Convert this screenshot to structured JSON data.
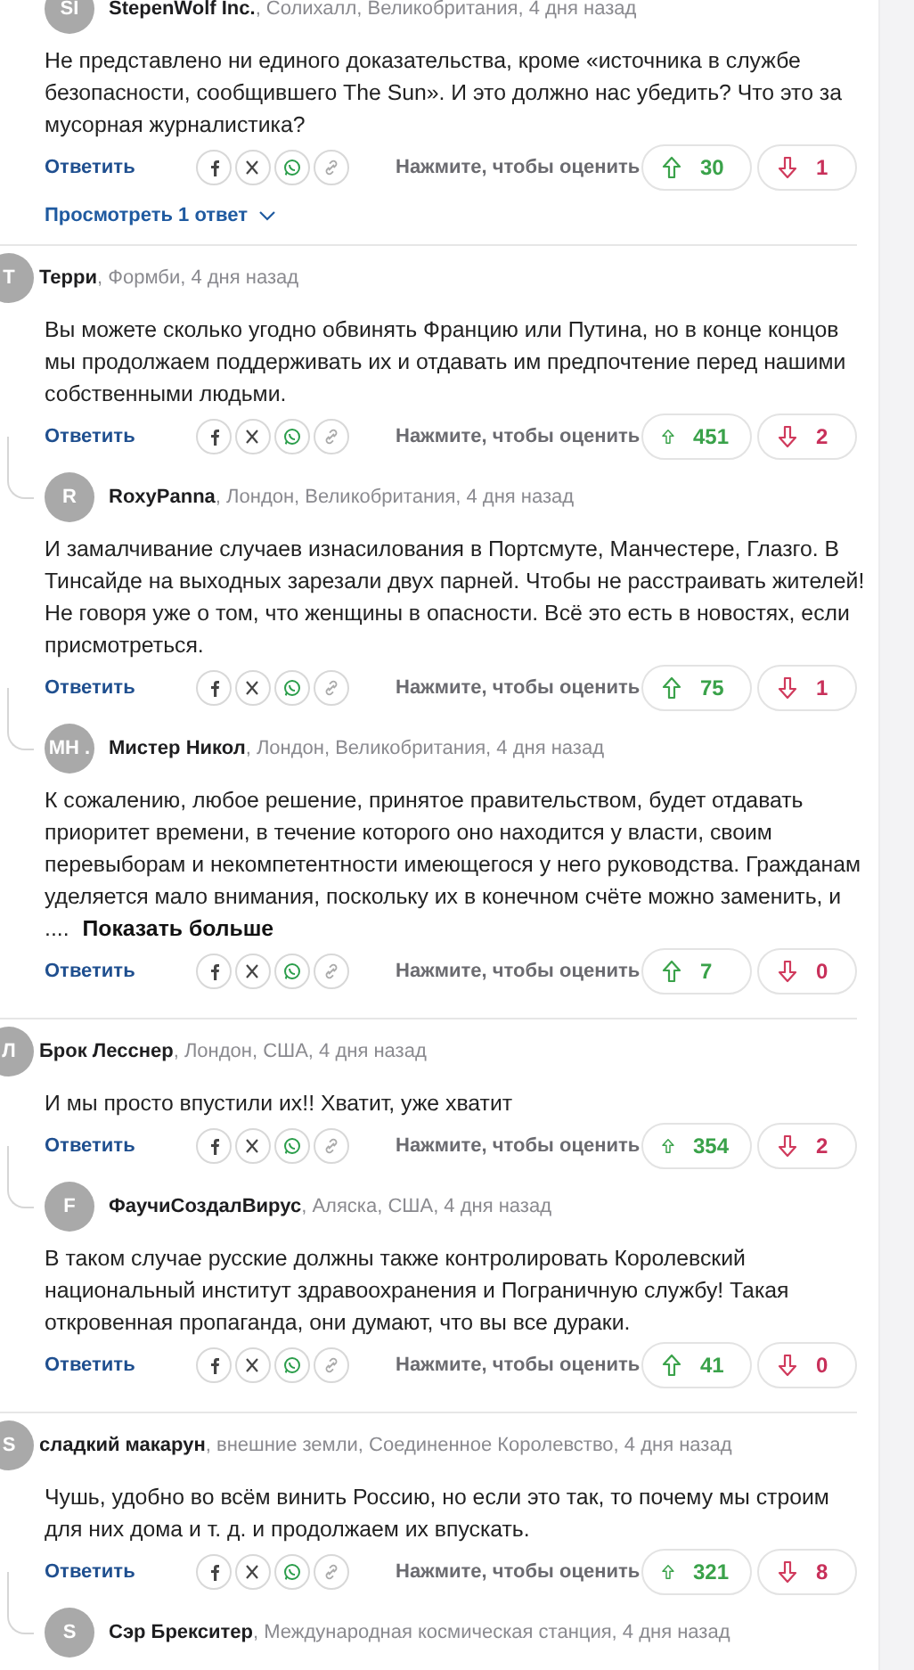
{
  "comments": [
    {
      "kind": "reply",
      "avatar": "SI",
      "name": "StepenWolf Inc.",
      "meta": ", Солихалл, Великобритания, 4 дня назад",
      "body": "Не представлено ни единого доказательства, кроме «источника в службе безопасности, сообщившего The Sun». И это должно нас убедить? Что это за мусорная журналистика?",
      "reply_label": "Ответить",
      "rate_label": "Нажмите, чтобы оценить",
      "up": "30",
      "down": "1",
      "view_replies": "Просмотреть 1 ответ"
    },
    {
      "kind": "top",
      "avatar": "T",
      "name": "Терри",
      "meta": ", Формби, 4 дня назад",
      "body": "Вы можете сколько угодно обвинять Францию или Путина, но в конце концов мы продолжаем поддерживать их и отдавать им предпочтение перед нашими собственными людьми.",
      "reply_label": "Ответить",
      "rate_label": "Нажмите, чтобы оценить",
      "up": "451",
      "down": "2"
    },
    {
      "kind": "reply",
      "avatar": "R",
      "name": "RoxyPanna",
      "meta": ", Лондон, Великобритания, 4 дня назад",
      "body": "И замалчивание случаев изнасилования в Портсмуте, Манчестере, Глазго. В Тинсайде на выходных зарезали двух парней. Чтобы не расстраивать жителей! Не говоря уже о том, что женщины в опасности. Всё это есть в новостях, если присмотреться.",
      "reply_label": "Ответить",
      "rate_label": "Нажмите, чтобы оценить",
      "up": "75",
      "down": "1"
    },
    {
      "kind": "reply",
      "avatar": "MH .",
      "name": "Мистер Никол",
      "meta": ", Лондон, Великобритания, 4 дня назад",
      "body": "К сожалению, любое решение, принятое правительством, будет отдавать приоритет времени, в течение которого оно находится у власти, своим перевыборам и некомпетентности имеющегося у него руководства. Гражданам уделяется мало внимания, поскольку их в конечном счёте можно заменить, и ....",
      "more": "Показать больше",
      "reply_label": "Ответить",
      "rate_label": "Нажмите, чтобы оценить",
      "up": "7",
      "down": "0"
    },
    {
      "kind": "top",
      "avatar": "Л",
      "name": "Брок Лесснер",
      "meta": ", Лондон, США, 4 дня назад",
      "body": "И мы просто впустили их!! Хватит, уже хватит",
      "reply_label": "Ответить",
      "rate_label": "Нажмите, чтобы оценить",
      "up": "354",
      "down": "2"
    },
    {
      "kind": "reply",
      "avatar": "F",
      "name": "ФаучиСоздалВирус",
      "meta": ", Аляска, США, 4 дня назад",
      "body": "В таком случае русские должны также контролировать Королевский национальный институт здравоохранения и Пограничную службу! Такая откровенная пропаганда, они думают, что вы все дураки.",
      "reply_label": "Ответить",
      "rate_label": "Нажмите, чтобы оценить",
      "up": "41",
      "down": "0"
    },
    {
      "kind": "top",
      "avatar": "S",
      "name": "сладкий макарун",
      "meta": ", внешние земли, Соединенное Королевство, 4 дня назад",
      "body": "Чушь, удобно во всём винить Россию, но если это так, то почему мы строим для них дома и т. д. и продолжаем их впускать.",
      "reply_label": "Ответить",
      "rate_label": "Нажмите, чтобы оценить",
      "up": "321",
      "down": "8"
    },
    {
      "kind": "reply",
      "avatar": "S",
      "name": "Сэр Брекситер",
      "meta": ", Международная космическая станция, 4 дня назад"
    }
  ]
}
